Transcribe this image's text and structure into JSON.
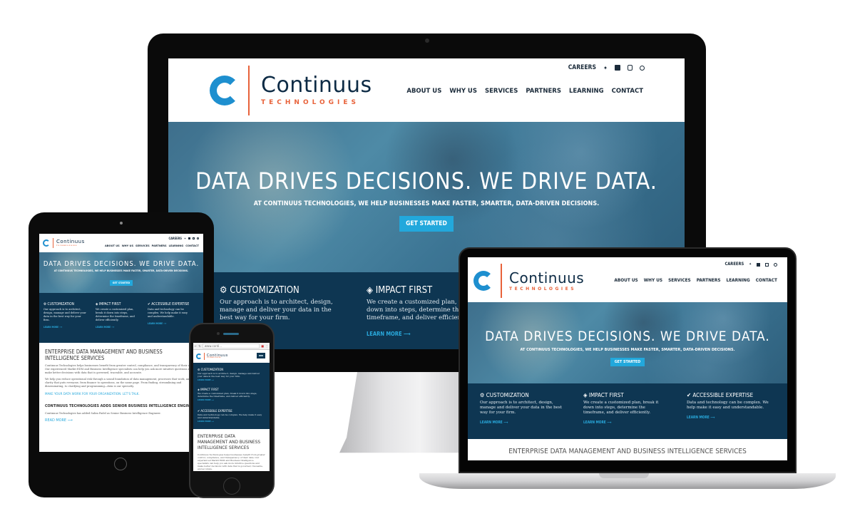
{
  "brand": {
    "name": "Continuus",
    "tagline": "TECHNOLOGIES",
    "primary_color": "#0d2b45",
    "accent_color": "#e8623a",
    "cta_color": "#22a8dc",
    "feature_bg": "#0e3652"
  },
  "header": {
    "top_links": {
      "careers": "CAREERS",
      "icons": [
        "twitter-icon",
        "linkedin-icon",
        "youtube-icon",
        "search-icon"
      ],
      "twitter_glyph": "🐦",
      "linkedin_glyph": "in",
      "youtube_glyph": "▶",
      "search_glyph": "⌕"
    },
    "nav": [
      "ABOUT US",
      "WHY US",
      "SERVICES",
      "PARTNERS",
      "LEARNING",
      "CONTACT"
    ]
  },
  "hero": {
    "title": "DATA DRIVES DECISIONS. WE DRIVE DATA.",
    "subtitle": "AT CONTINUUS TECHNOLOGIES, WE HELP BUSINESSES MAKE FASTER, SMARTER, DATA-DRIVEN DECISIONS.",
    "cta": "GET STARTED"
  },
  "features": [
    {
      "icon": "gears-icon",
      "glyph": "⚙",
      "title": "CUSTOMIZATION",
      "desc": "Our approach is to architect, design, manage and deliver your data in the best way for your firm.",
      "link": "LEARN MORE ⟶"
    },
    {
      "icon": "diamond-icon",
      "glyph": "◈",
      "title": "IMPACT FIRST",
      "desc": "We create a customized plan, break it down into steps, determine the timeframe, and deliver efficiently.",
      "link": "LEARN MORE ⟶"
    },
    {
      "icon": "check-circle-icon",
      "glyph": "✔",
      "title": "ACCESSIBLE EXPERTISE",
      "desc": "Data and technology can be complex. We help make it easy and understandable.",
      "link": "LEARN MORE ⟶"
    }
  ],
  "content": {
    "section_title": "ENTERPRISE DATA MANAGEMENT AND BUSINESS INTELLIGENCE SERVICES",
    "para1": "Continuus Technologies helps businesses benefit from greater control, compliance, and transparency of their data. Our experienced Markit EDM and Business Intelligence specialists can help you ask more intuitive questions and make better decisions with data that is governed, traceable, and accurate.",
    "para2": "We help you reduce operational risk through a sound foundation of data management, processes that work, and clarity that puts everyone, from finance to operations, on the same page. From finding, streamlining and disseminating, to clarifying and programming—data is our specialty.",
    "cta_link": "MAKE YOUR DATA WORK FOR YOUR ORGANIZATION. LET'S TALK.",
    "news_title": "CONTINUUS TECHNOLOGIES ADDS SENIOR BUSINESS INTELLIGENCE ENGINEER",
    "news_desc": "Continuus Technologies has added Salim Fadel as Senior Business Intelligence Engineer.",
    "read_more": "READ MORE ⟶"
  },
  "phone": {
    "url": "www.conti...",
    "section_title_partial": "ENTERPRISE DATA MANAGEMENT AND BUSINESS INTELLIGENCE SERVICES",
    "para_partial": "Continuus Technologies helps businesses benefit from greater control, compliance, and transparency of their data. Our experienced Markit EDM and Business Intelligence specialists can help you ask more intuitive questions and make better decisions with data that is governed, traceable, and accurate."
  }
}
